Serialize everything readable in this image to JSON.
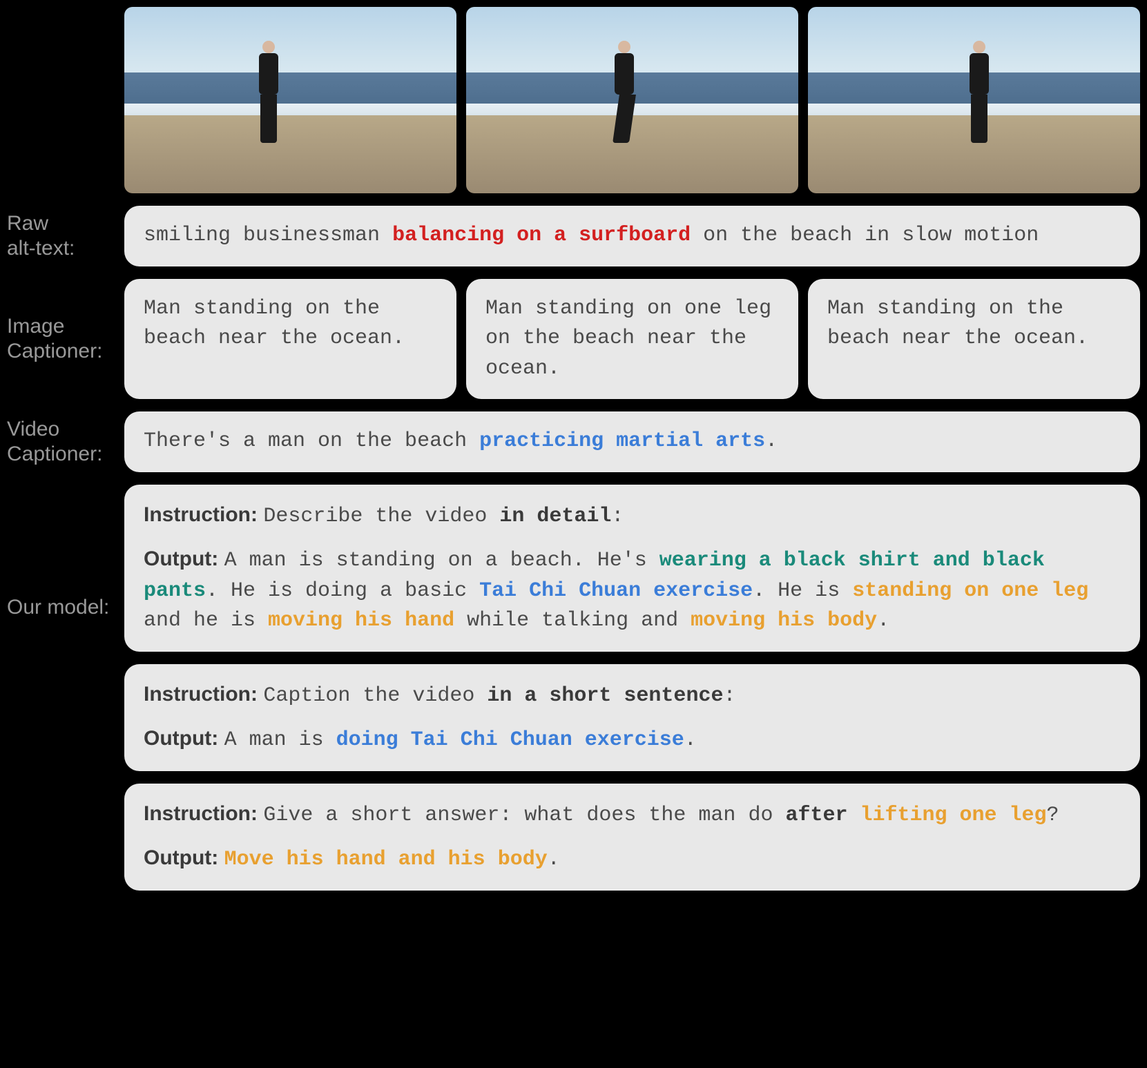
{
  "labels": {
    "raw_alt": "Raw\nalt-text:",
    "image_cap": "Image\nCaptioner:",
    "video_cap": "Video\nCaptioner:",
    "our_model": "Our model:"
  },
  "raw_alt": {
    "pre": "smiling businessman ",
    "highlight": "balancing on a surfboard",
    "post": " on the beach in slow motion"
  },
  "image_captions": [
    "Man standing on the beach near the ocean.",
    "Man standing on one leg on the beach near the ocean.",
    "Man standing on the beach near the ocean."
  ],
  "video_caption": {
    "pre": "There's a man on the beach ",
    "highlight": "practicing martial arts",
    "post": "."
  },
  "our_model": [
    {
      "instruction_label": "Instruction:",
      "instr_pre": "Describe the video ",
      "instr_bold": "in detail",
      "instr_post": ":",
      "output_label": "Output:",
      "segments": [
        {
          "t": "A man is standing on a beach. He's ",
          "c": "plain"
        },
        {
          "t": "wearing a black shirt and black pants",
          "c": "teal"
        },
        {
          "t": ". He is doing a basic ",
          "c": "plain"
        },
        {
          "t": "Tai Chi Chuan exercise",
          "c": "blue"
        },
        {
          "t": ". He is ",
          "c": "plain"
        },
        {
          "t": "standing on one leg",
          "c": "orange"
        },
        {
          "t": " and he is ",
          "c": "plain"
        },
        {
          "t": "moving his hand",
          "c": "orange"
        },
        {
          "t": " while talking and ",
          "c": "plain"
        },
        {
          "t": "moving his body",
          "c": "orange"
        },
        {
          "t": ".",
          "c": "plain"
        }
      ]
    },
    {
      "instruction_label": "Instruction:",
      "instr_pre": "Caption the video ",
      "instr_bold": "in a short sentence",
      "instr_post": ":",
      "output_label": "Output:",
      "segments": [
        {
          "t": "A man is ",
          "c": "plain"
        },
        {
          "t": "doing Tai Chi Chuan exercise",
          "c": "blue"
        },
        {
          "t": ".",
          "c": "plain"
        }
      ]
    },
    {
      "instruction_label": "Instruction:",
      "instr_pre": "Give a short answer: what does the man do ",
      "instr_bold": "after ",
      "instr_orange": "lifting one leg",
      "instr_post": "?",
      "output_label": "Output:",
      "segments": [
        {
          "t": "Move his hand and his body",
          "c": "orange"
        },
        {
          "t": ".",
          "c": "plain"
        }
      ]
    }
  ]
}
